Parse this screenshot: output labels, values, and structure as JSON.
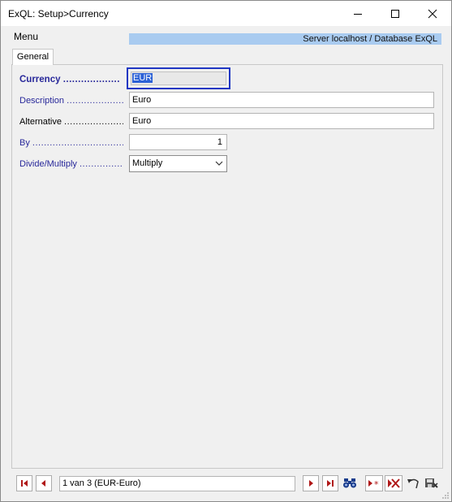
{
  "window": {
    "title": "ExQL: Setup>Currency"
  },
  "menubar": {
    "menu_label": "Menu",
    "server_info": "Server localhost / Database ExQL"
  },
  "tabs": [
    {
      "label": "General"
    }
  ],
  "form": {
    "currency": {
      "label": "Currency",
      "dots": "...................",
      "value": "EUR"
    },
    "description": {
      "label": "Description",
      "dots": "...........................",
      "value": "Euro"
    },
    "alternative": {
      "label": "Alternative",
      "dots": "...........................",
      "value": "Euro"
    },
    "by": {
      "label": "By",
      "dots": "........................................",
      "value": "1"
    },
    "divide_multiply": {
      "label": "Divide/Multiply",
      "dots": "...................",
      "value": "Multiply"
    }
  },
  "navigation": {
    "record_text": "1 van 3 (EUR-Euro)"
  },
  "colors": {
    "label_blue": "#28289a",
    "focus_border": "#1f36c3",
    "server_bar": "#a9cbf0",
    "nav_red": "#b01818"
  }
}
